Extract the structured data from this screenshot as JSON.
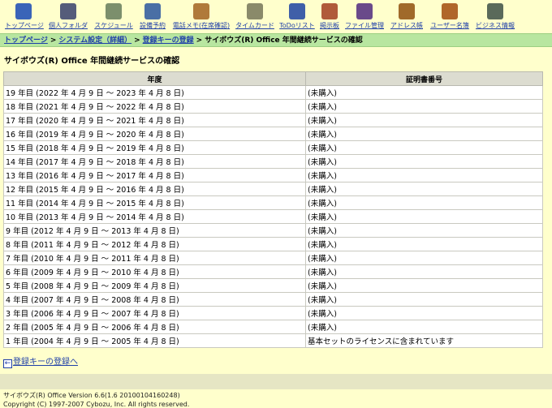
{
  "apps": [
    {
      "label": "トップページ",
      "icon": "top-page-icon",
      "color": "#3a64b8"
    },
    {
      "label": "個人フォルダ",
      "icon": "personal-folder-icon",
      "color": "#555c7a"
    },
    {
      "label": "スケジュール",
      "icon": "schedule-icon",
      "color": "#7c8f6c"
    },
    {
      "label": "設備予約",
      "icon": "facility-reservation-icon",
      "color": "#4a6fa5"
    },
    {
      "label": "電話メモ(在席確認)",
      "icon": "phone-memo-icon",
      "color": "#b07a3a"
    },
    {
      "label": "タイムカード",
      "icon": "timecard-icon",
      "color": "#8a8a6a"
    },
    {
      "label": "ToDoリスト",
      "icon": "todo-list-icon",
      "color": "#3f5fa8"
    },
    {
      "label": "掲示板",
      "icon": "bulletin-board-icon",
      "color": "#b05a3a"
    },
    {
      "label": "ファイル管理",
      "icon": "file-management-icon",
      "color": "#6a4a8a"
    },
    {
      "label": "アドレス帳",
      "icon": "address-book-icon",
      "color": "#a06a2a"
    },
    {
      "label": "ユーザー名簿",
      "icon": "user-directory-icon",
      "color": "#b0662a"
    },
    {
      "label": "ビジネス情報",
      "icon": "business-info-icon",
      "color": "#5a6a5a"
    }
  ],
  "breadcrumb": {
    "items": [
      "トップページ",
      "システム設定（詳細）",
      "登録キーの登録"
    ],
    "current": "サイボウズ(R) Office 年間継続サービスの確認",
    "separator": ">"
  },
  "page_title": "サイボウズ(R) Office 年間継続サービスの確認",
  "table": {
    "headers": [
      "年度",
      "証明書番号"
    ],
    "rows": [
      [
        "19 年目 (2022 年 4 月 9 日 ～ 2023 年 4 月 8 日)",
        "(未購入)"
      ],
      [
        "18 年目 (2021 年 4 月 9 日 ～ 2022 年 4 月 8 日)",
        "(未購入)"
      ],
      [
        "17 年目 (2020 年 4 月 9 日 ～ 2021 年 4 月 8 日)",
        "(未購入)"
      ],
      [
        "16 年目 (2019 年 4 月 9 日 ～ 2020 年 4 月 8 日)",
        "(未購入)"
      ],
      [
        "15 年目 (2018 年 4 月 9 日 ～ 2019 年 4 月 8 日)",
        "(未購入)"
      ],
      [
        "14 年目 (2017 年 4 月 9 日 ～ 2018 年 4 月 8 日)",
        "(未購入)"
      ],
      [
        "13 年目 (2016 年 4 月 9 日 ～ 2017 年 4 月 8 日)",
        "(未購入)"
      ],
      [
        "12 年目 (2015 年 4 月 9 日 ～ 2016 年 4 月 8 日)",
        "(未購入)"
      ],
      [
        "11 年目 (2014 年 4 月 9 日 ～ 2015 年 4 月 8 日)",
        "(未購入)"
      ],
      [
        "10 年目 (2013 年 4 月 9 日 ～ 2014 年 4 月 8 日)",
        "(未購入)"
      ],
      [
        "9 年目 (2012 年 4 月 9 日 ～ 2013 年 4 月 8 日)",
        "(未購入)"
      ],
      [
        "8 年目 (2011 年 4 月 9 日 ～ 2012 年 4 月 8 日)",
        "(未購入)"
      ],
      [
        "7 年目 (2010 年 4 月 9 日 ～ 2011 年 4 月 8 日)",
        "(未購入)"
      ],
      [
        "6 年目 (2009 年 4 月 9 日 ～ 2010 年 4 月 8 日)",
        "(未購入)"
      ],
      [
        "5 年目 (2008 年 4 月 9 日 ～ 2009 年 4 月 8 日)",
        "(未購入)"
      ],
      [
        "4 年目 (2007 年 4 月 9 日 ～ 2008 年 4 月 8 日)",
        "(未購入)"
      ],
      [
        "3 年目 (2006 年 4 月 9 日 ～ 2007 年 4 月 8 日)",
        "(未購入)"
      ],
      [
        "2 年目 (2005 年 4 月 9 日 ～ 2006 年 4 月 8 日)",
        "(未購入)"
      ],
      [
        "1 年目 (2004 年 4 月 9 日 ～ 2005 年 4 月 8 日)",
        "基本セットのライセンスに含まれています"
      ]
    ]
  },
  "back_link": {
    "label": "登録キーの登録へ",
    "icon": "back-arrow-icon"
  },
  "footer": {
    "version": "サイボウズ(R) Office Version 6.6(1.6 20100104160248)",
    "copyright": "Copyright (C) 1997-2007 Cybozu, Inc. All rights reserved."
  }
}
